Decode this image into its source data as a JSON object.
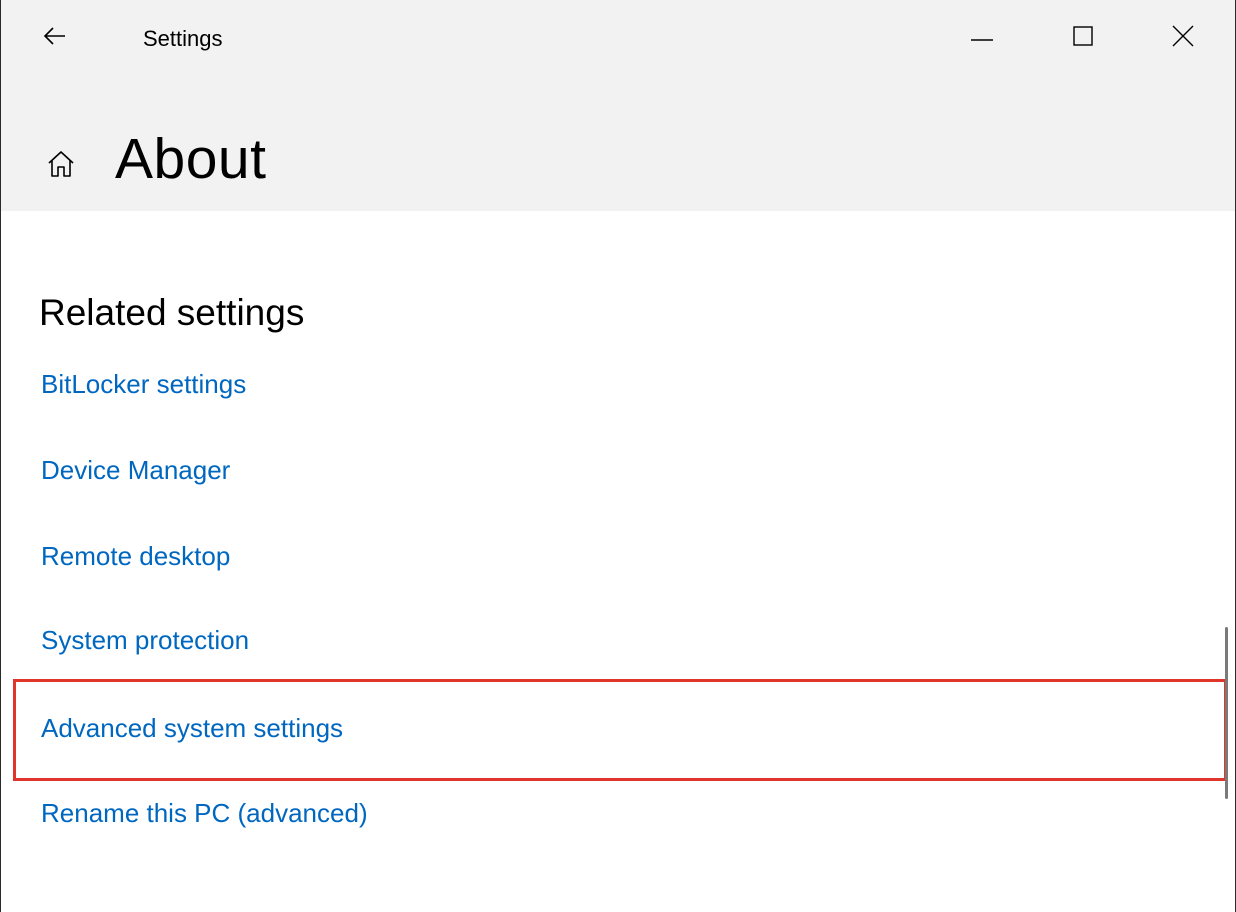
{
  "window": {
    "title": "Settings",
    "controls": {
      "minimize": "minimize-icon",
      "maximize": "maximize-icon",
      "close": "close-icon"
    }
  },
  "page": {
    "title": "About",
    "back_icon": "back-arrow-icon",
    "home_icon": "home-icon"
  },
  "related_settings": {
    "heading": "Related settings",
    "links": [
      "BitLocker settings",
      "Device Manager",
      "Remote desktop",
      "System protection",
      "Advanced system settings",
      "Rename this PC (advanced)"
    ],
    "highlighted": "Advanced system settings"
  },
  "colors": {
    "header_background": "#f2f2f2",
    "link": "#0067c0",
    "highlight_border": "#e0352b"
  }
}
